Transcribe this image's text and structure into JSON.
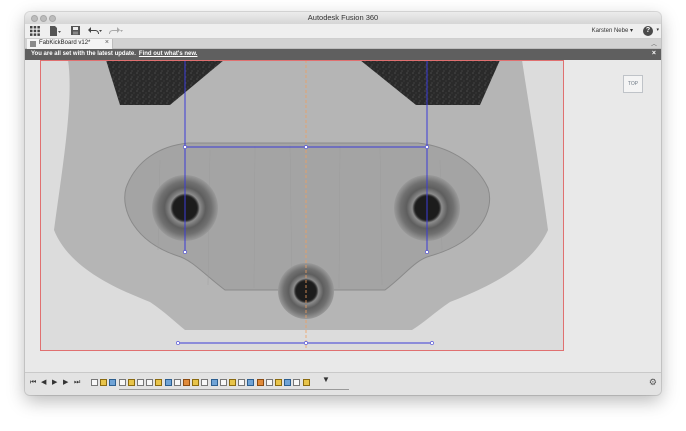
{
  "window": {
    "title": "Autodesk Fusion 360"
  },
  "toolbar": {
    "user": "Karsten Nebe ▾",
    "help": "?",
    "icons": [
      "grid-icon",
      "file-icon",
      "save-icon",
      "undo-icon",
      "redo-icon"
    ]
  },
  "tabs": [
    {
      "label": "FabKickBoard v12*"
    }
  ],
  "notification": {
    "message": "You are all set with the latest update.",
    "link": "Find out what's new."
  },
  "viewcube": {
    "face": "TOP"
  },
  "timeline": {
    "controls": [
      "go-to-start",
      "step-back",
      "play",
      "step-forward",
      "go-to-end"
    ],
    "feature_count": 24
  },
  "colors": {
    "sketch_line": "#3b3bd6",
    "axis": "#f0a060",
    "canvas_border": "#e07070",
    "notification_bg": "#5f5f5f"
  }
}
